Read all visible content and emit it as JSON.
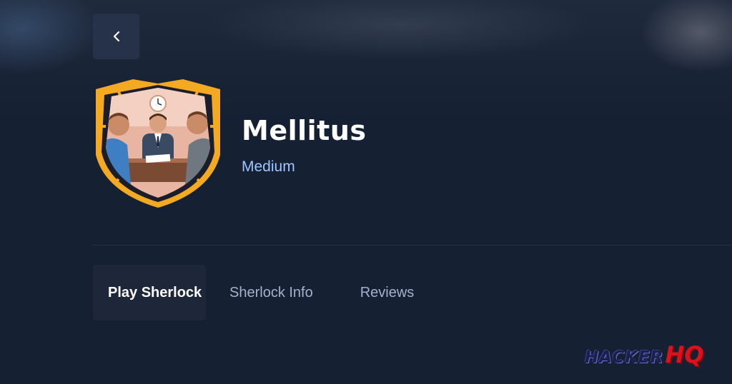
{
  "header": {
    "back_icon": "chevron-left-icon"
  },
  "machine": {
    "name": "Mellitus",
    "difficulty": "Medium",
    "badge_icon": "shield-badge-meeting-icon"
  },
  "tabs": [
    {
      "label": "Play Sherlock",
      "active": true
    },
    {
      "label": "Sherlock Info",
      "active": false
    },
    {
      "label": "Reviews",
      "active": false
    }
  ],
  "watermark": {
    "part1": "HACKER",
    "part2": "HQ"
  },
  "colors": {
    "background": "#162033",
    "accent_difficulty": "#9fc5ff",
    "badge_gold": "#f4a923",
    "logo_red": "#d9131c"
  }
}
